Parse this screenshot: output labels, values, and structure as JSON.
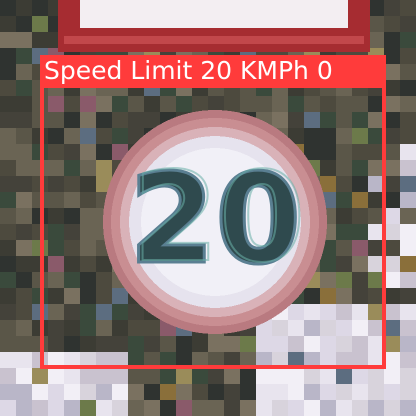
{
  "image": {
    "subject": "speed-limit-sign",
    "detection": {
      "label": "Speed Limit 20 KMPh 0",
      "box_color": "#ff3b3b",
      "label_text_color": "#ffffff"
    },
    "sign_number": "20"
  }
}
